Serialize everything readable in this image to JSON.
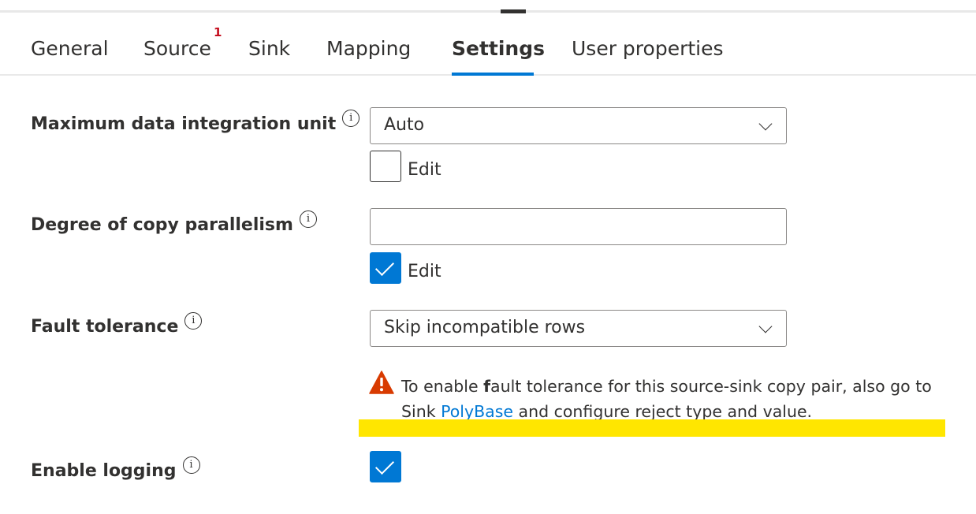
{
  "tabs": [
    {
      "label": "General"
    },
    {
      "label": "Source",
      "badge": "1"
    },
    {
      "label": "Sink"
    },
    {
      "label": "Mapping"
    },
    {
      "label": "Settings",
      "active": true
    },
    {
      "label": "User properties"
    }
  ],
  "settings": {
    "max_diu": {
      "label": "Maximum data integration unit",
      "value": "Auto",
      "edit_label": "Edit",
      "edit_checked": false
    },
    "parallelism": {
      "label": "Degree of copy parallelism",
      "value": "",
      "edit_label": "Edit",
      "edit_checked": true
    },
    "fault_tolerance": {
      "label": "Fault tolerance",
      "value": "Skip incompatible rows",
      "warning_prefix": "To enable ",
      "warning_bold": "f",
      "warning_mid": "ault tolerance for this source-sink copy pair, also go to Sink ",
      "warning_link": "PolyBase",
      "warning_suffix": " and configure reject type and value."
    },
    "logging": {
      "label": "Enable logging",
      "checked": true
    }
  },
  "icons": {
    "info": "info-icon",
    "chevron": "chevron-down-icon",
    "warning": "warning-icon"
  },
  "colors": {
    "accent": "#0078d4",
    "badge": "#c50f1f",
    "warning": "#d83b01",
    "highlight": "#ffe600"
  }
}
